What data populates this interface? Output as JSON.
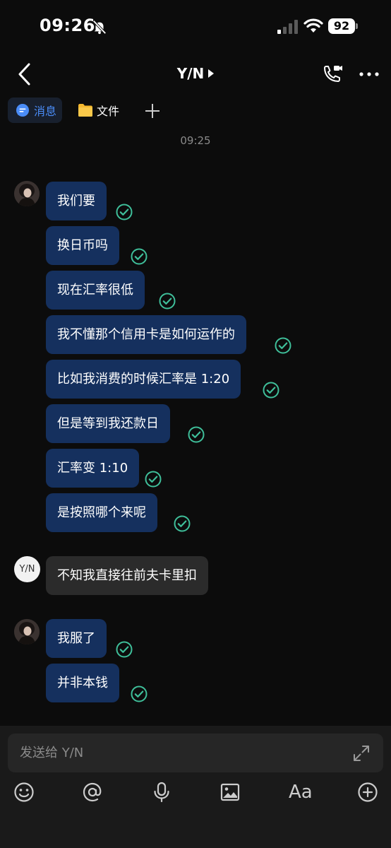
{
  "status_bar": {
    "time": "09:26",
    "battery": "92"
  },
  "header": {
    "title": "Y/N"
  },
  "tabs": [
    {
      "label": "消息",
      "icon": "chat-bubble-icon",
      "active": true
    },
    {
      "label": "文件",
      "icon": "folder-icon",
      "active": false
    }
  ],
  "chat": {
    "timestamp": "09:25",
    "group1": [
      "我们要",
      "换日币吗",
      "现在汇率很低",
      "我不懂那个信用卡是如何运作的",
      "比如我消费的时候汇率是 1:20",
      "但是等到我还款日",
      "汇率变 1:10",
      "是按照哪个来呢"
    ],
    "contact_avatar": "Y/N",
    "contact_message": "不知我直接往前夫卡里扣",
    "group2": [
      "我服了",
      "并非本钱"
    ]
  },
  "composer": {
    "placeholder": "发送给 Y/N",
    "font_button": "Aa"
  },
  "colors": {
    "background": "#0c0c0c",
    "own_bubble": "#15305e",
    "contact_bubble": "#2b2b2b",
    "read_check": "#3fbf9a",
    "accent_blue": "#4a8cf7"
  }
}
